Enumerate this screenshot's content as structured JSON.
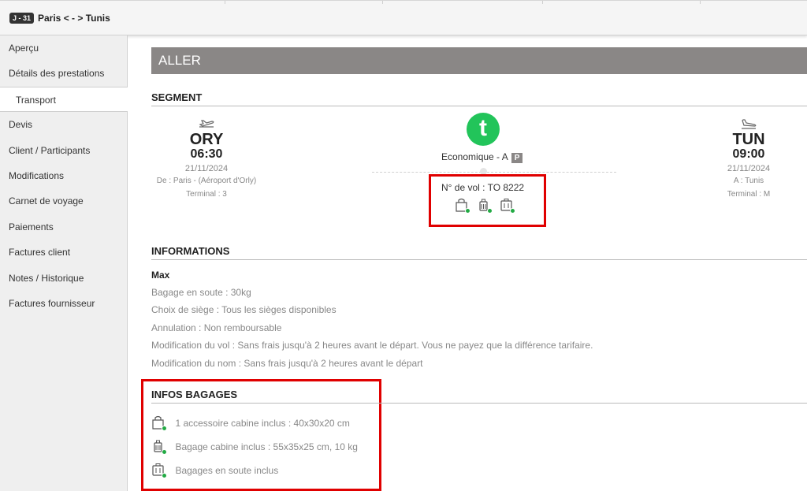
{
  "header": {
    "badge": "J - 31",
    "route": "Paris < - > Tunis"
  },
  "sidebar": {
    "items": [
      {
        "label": "Aperçu",
        "active": false
      },
      {
        "label": "Détails des prestations",
        "active": false
      },
      {
        "label": "Transport",
        "active": true
      },
      {
        "label": "Devis",
        "active": false
      },
      {
        "label": "Client / Participants",
        "active": false
      },
      {
        "label": "Modifications",
        "active": false
      },
      {
        "label": "Carnet de voyage",
        "active": false
      },
      {
        "label": "Paiements",
        "active": false
      },
      {
        "label": "Factures client",
        "active": false
      },
      {
        "label": "Notes / Historique",
        "active": false
      },
      {
        "label": "Factures fournisseur",
        "active": false
      }
    ]
  },
  "main": {
    "banner": "ALLER",
    "segment_title": "SEGMENT",
    "departure": {
      "code": "ORY",
      "time": "06:30",
      "date": "21/11/2024",
      "place": "De : Paris - (Aéroport d'Orly)",
      "terminal": "Terminal : 3",
      "icon": "takeoff-icon"
    },
    "arrival": {
      "code": "TUN",
      "time": "09:00",
      "date": "21/11/2024",
      "place": "A : Tunis",
      "terminal": "Terminal : M",
      "icon": "landing-icon"
    },
    "airline_logo_letter": "t",
    "cabin": "Economique - A",
    "cabin_badge": "P",
    "flight_number": "N° de vol : TO 8222",
    "informations_title": "INFORMATIONS",
    "fare_name": "Max",
    "info_lines": [
      "Bagage en soute : 30kg",
      "Choix de siège : Tous les sièges disponibles",
      "Annulation : Non remboursable",
      "Modification du vol : Sans frais jusqu'à 2 heures avant le départ. Vous ne payez que la différence tarifaire.",
      "Modification du nom : Sans frais jusqu'à 2 heures avant le départ"
    ],
    "bagages_title": "INFOS BAGAGES",
    "bagages": [
      {
        "icon": "bag-accessory-icon",
        "text": "1 accessoire cabine inclus : 40x30x20 cm"
      },
      {
        "icon": "cabin-suitcase-icon",
        "text": "Bagage cabine inclus : 55x35x25 cm, 10 kg"
      },
      {
        "icon": "checked-bag-icon",
        "text": "Bagages en soute inclus"
      }
    ]
  },
  "colors": {
    "accent_green": "#22c45a",
    "included_dot": "#22aa44",
    "highlight_red": "#e00000",
    "banner_gray": "#8a8786"
  }
}
